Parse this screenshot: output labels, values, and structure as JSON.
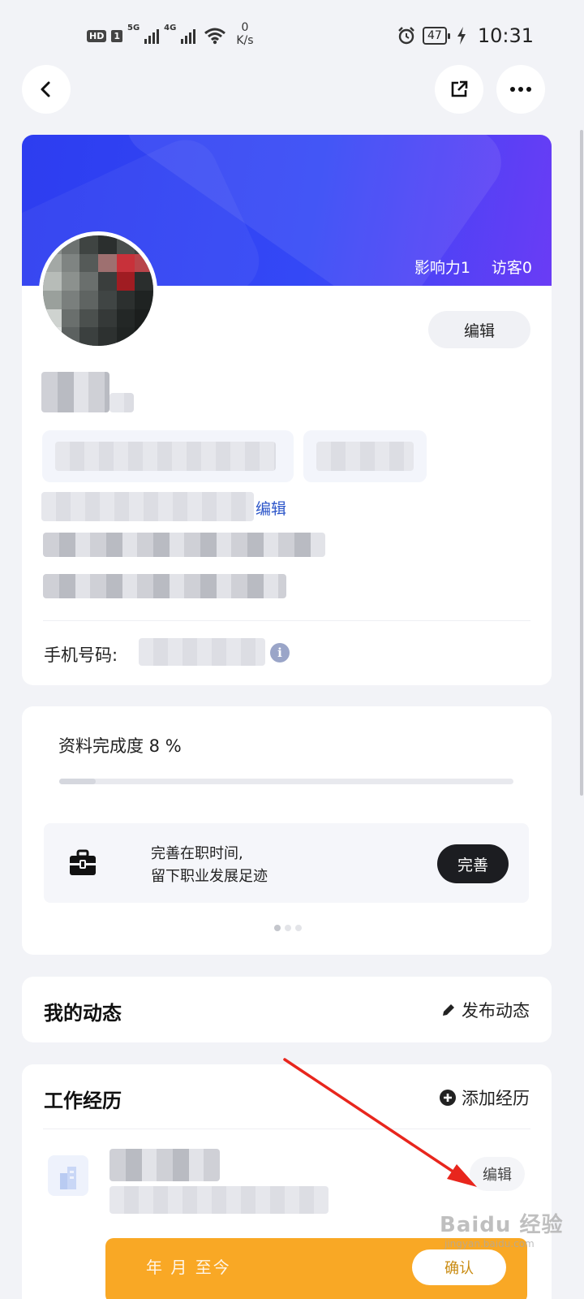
{
  "status_bar": {
    "hd": "HD",
    "sim": "1",
    "net1": "5G",
    "net2": "4G",
    "speed_value": "0",
    "speed_unit": "K/s",
    "battery": "47",
    "time": "10:31"
  },
  "top_bar": {
    "back_icon": "chevron-left-icon",
    "share_icon": "share-out-icon",
    "more_icon": "ellipsis-icon"
  },
  "profile": {
    "influence_label": "影响力1",
    "visitors_label": "访客0",
    "edit_label": "编辑",
    "inline_edit_label": "编辑",
    "phone_label": "手机号码:",
    "info_icon": "info-icon"
  },
  "completion": {
    "title": "资料完成度 8 %",
    "progress": 0.08,
    "tip_line1": "完善在职时间,",
    "tip_line2": "留下职业发展足迹",
    "tip_button": "完善",
    "tip_icon": "briefcase-icon",
    "pages": 3,
    "active_page": 0
  },
  "dynamics": {
    "title": "我的动态",
    "action_label": "发布动态",
    "action_icon": "pencil-icon"
  },
  "work": {
    "title": "工作经历",
    "action_label": "添加经历",
    "action_icon": "plus-circle-icon",
    "edit_label": "编辑",
    "logo_icon": "building-icon",
    "banner_text": "年 月 至今",
    "banner_button": "确认"
  },
  "colors": {
    "banner_start": "#2d3df0",
    "banner_end": "#6a3cf5",
    "link": "#2d56c9",
    "dark_button": "#1c1d21",
    "annotation_arrow": "#e8261d",
    "yellow": "#f9a825"
  },
  "watermark": {
    "main": "Baidu 经验",
    "sub": "jingyan.baidu.com"
  }
}
